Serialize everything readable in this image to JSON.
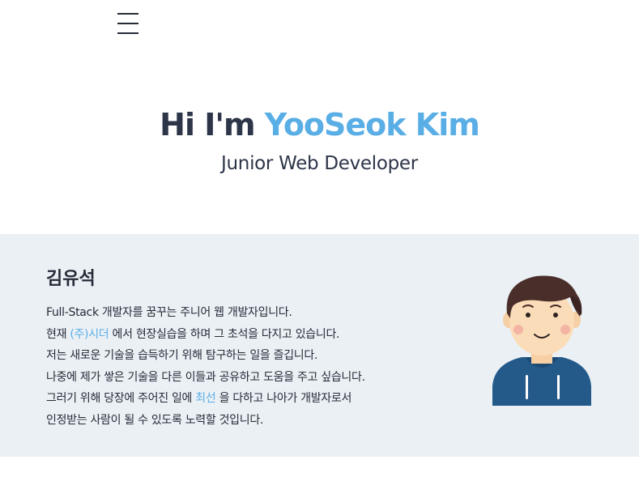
{
  "nav": {
    "menu_icon": "hamburger-icon"
  },
  "hero": {
    "greeting": "Hi I'm ",
    "name": "YooSeok Kim",
    "subtitle": "Junior Web Developer"
  },
  "about": {
    "name": "김유석",
    "line1": "Full-Stack 개발자를 꿈꾸는 주니어 웹 개발자입니다.",
    "line2_before": "현재 ",
    "line2_company": "(주)시더",
    "line2_after": " 에서 현장실습을 하며 그 초석을 다지고 있습니다.",
    "line3": "저는 새로운 기술을 습득하기 위해 탐구하는 일을 즐깁니다.",
    "line4": "나중에 제가 쌓은 기술을 다른 이들과 공유하고 도움을 주고 싶습니다.",
    "line5_before": "그러기 위해 당장에 주어진 일에 ",
    "line5_highlight": "최선",
    "line5_after": " 을 다하고 나아가 개발자로서",
    "line6": "인정받는 사람이 될 수 있도록 노력할 것입니다.",
    "avatar_icon": "developer-avatar-icon"
  },
  "colors": {
    "accent": "#5aaee6",
    "heading": "#2d3548",
    "section_bg": "#ebf0f5"
  }
}
